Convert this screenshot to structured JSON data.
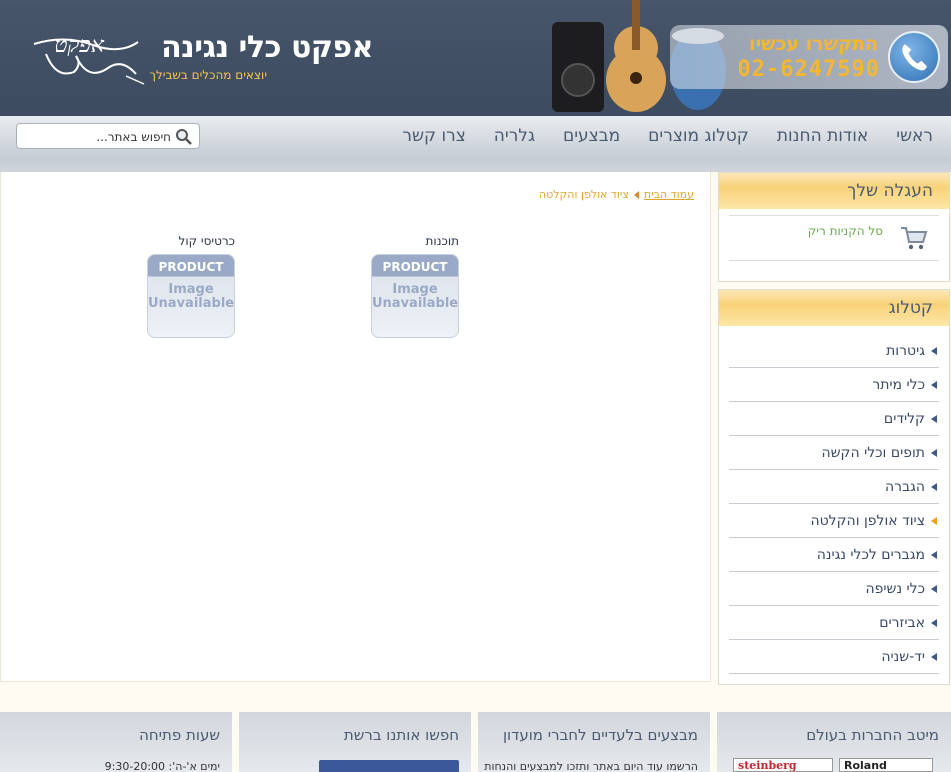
{
  "header": {
    "site_title": "אפקט כלי נגינה",
    "slogan": "יוצאים מהכלים בשבילך",
    "logo_text": "אפקט",
    "call_cta": "התקשרו עכשיו",
    "phone": "02-6247590"
  },
  "nav": {
    "items": [
      {
        "label": "ראשי"
      },
      {
        "label": "אודות החנות"
      },
      {
        "label": "קטלוג מוצרים"
      },
      {
        "label": "מבצעים"
      },
      {
        "label": "גלריה"
      },
      {
        "label": "צרו קשר"
      }
    ],
    "search_value": "חיפוש באתר..."
  },
  "breadcrumb": {
    "home": "עמוד הבית",
    "current": "ציוד אולפן והקלטה"
  },
  "categories": [
    {
      "title": "תוכנות",
      "image_line1": "PRODUCT",
      "image_line2": "Image",
      "image_line3": "Unavailable"
    },
    {
      "title": "כרטיסי קול",
      "image_line1": "PRODUCT",
      "image_line2": "Image",
      "image_line3": "Unavailable"
    }
  ],
  "cart": {
    "title": "העגלה שלך",
    "status": "סל הקניות ריק"
  },
  "catalog": {
    "title": "קטלוג",
    "items": [
      {
        "label": "גיטרות"
      },
      {
        "label": "כלי מיתר"
      },
      {
        "label": "קלידים"
      },
      {
        "label": "תופים וכלי הקשה"
      },
      {
        "label": "הגברה"
      },
      {
        "label": "ציוד אולפן והקלטה",
        "active": true
      },
      {
        "label": "מגברים לכלי נגינה"
      },
      {
        "label": "כלי נשיפה"
      },
      {
        "label": "אביזרים"
      },
      {
        "label": "יד-שניה"
      }
    ]
  },
  "footer": {
    "brands_title": "מיטב החברות בעולם",
    "brand1": "steinberg",
    "brand2": "Roland",
    "club_title": "מבצעים בלעדיים לחברי מועדון",
    "club_text": "הרשמו עוד היום באתר ותזכו למבצעים והנחות",
    "social_title": "חפשו אותנו ברשת",
    "hours_title": "שעות פתיחה",
    "hours_text": "ימים א'-ה': 9:30-20:00"
  },
  "colors": {
    "header_bg": "#46556a",
    "accent_gold": "#f5b731",
    "link_gold": "#e2a62e",
    "nav_text": "#4a5a70"
  }
}
